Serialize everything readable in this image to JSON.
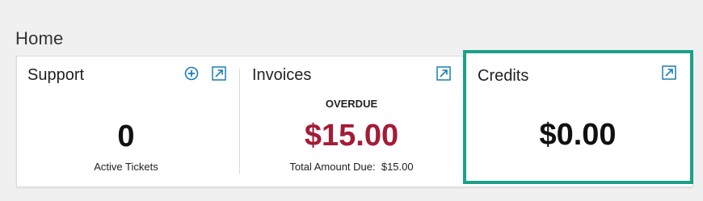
{
  "page": {
    "title": "Home"
  },
  "support": {
    "title": "Support",
    "count": "0",
    "count_label": "Active Tickets",
    "add_icon": "plus-circle-icon",
    "open_icon": "external-link-icon"
  },
  "invoices": {
    "title": "Invoices",
    "status": "OVERDUE",
    "amount": "$15.00",
    "total_label": "Total Amount Due:  $15.00",
    "open_icon": "external-link-icon"
  },
  "credits": {
    "title": "Credits",
    "amount": "$0.00",
    "open_icon": "external-link-icon"
  },
  "colors": {
    "accent": "#1a7fb0",
    "overdue": "#a31c37",
    "highlight": "#1aa189",
    "background": "#f0f0f0"
  }
}
